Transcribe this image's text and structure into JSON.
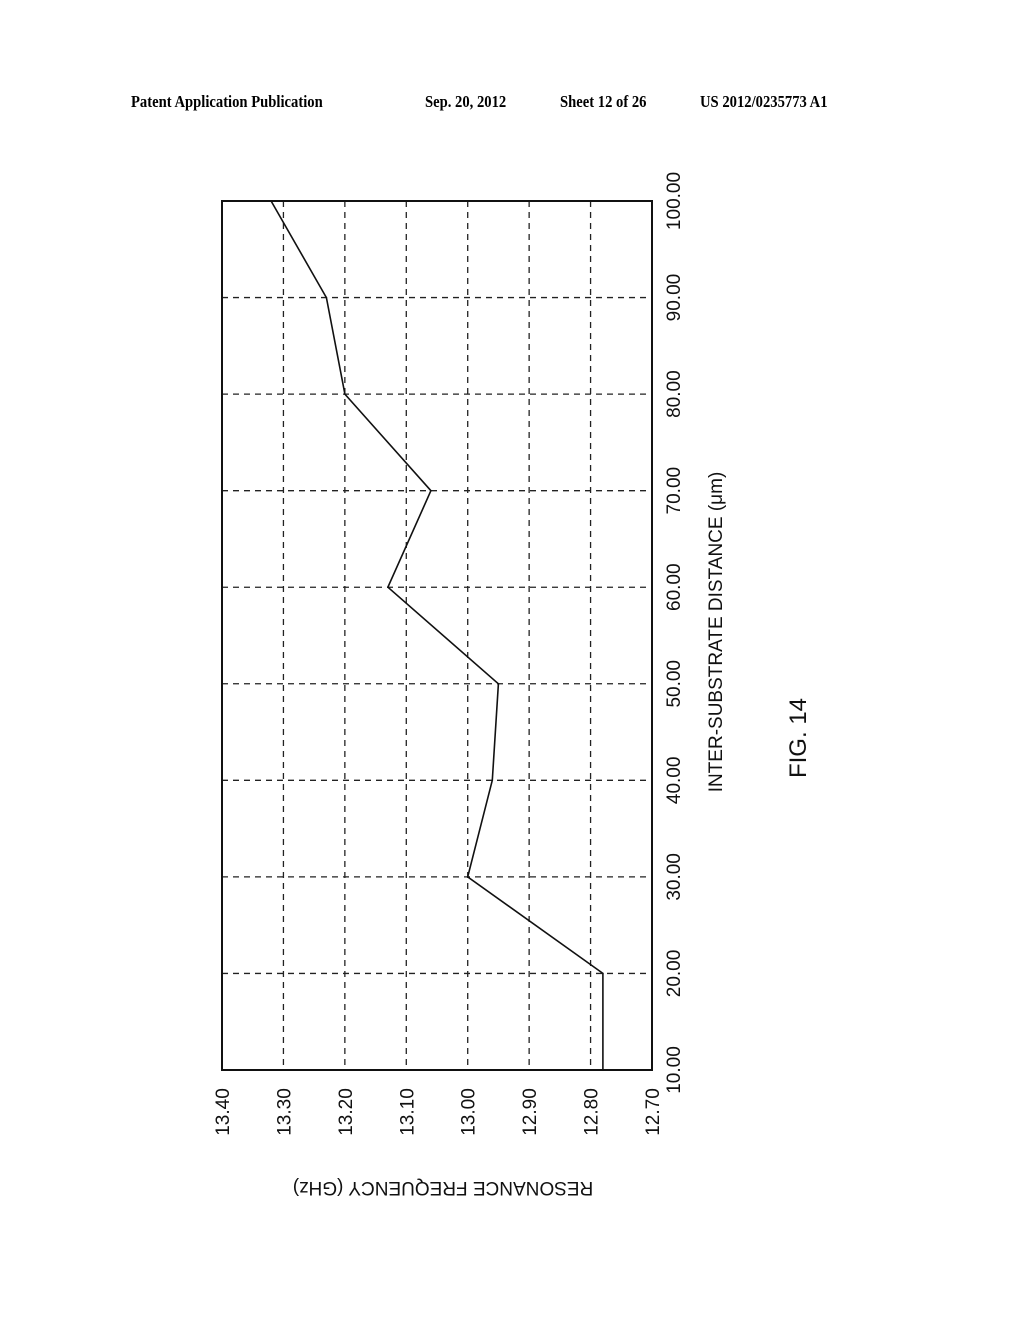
{
  "header": {
    "publication": "Patent Application Publication",
    "date": "Sep. 20, 2012",
    "sheet": "Sheet 12 of 26",
    "number": "US 2012/0235773 A1"
  },
  "figure_label": "FIG. 14",
  "chart_data": {
    "type": "line",
    "title": "",
    "orientation": "rotated 90° counter-clockwise on the page",
    "xlabel": "INTER-SUBSTRATE DISTANCE (μm)",
    "ylabel": "RESONANCE FREQUENCY (GHz)",
    "xlim": [
      10,
      100
    ],
    "ylim": [
      12.7,
      13.4
    ],
    "x_ticks": [
      "10.00",
      "20.00",
      "30.00",
      "40.00",
      "50.00",
      "60.00",
      "70.00",
      "80.00",
      "90.00",
      "100.00"
    ],
    "y_ticks": [
      "12.70",
      "12.80",
      "12.90",
      "13.00",
      "13.10",
      "13.20",
      "13.30",
      "13.40"
    ],
    "grid": "dashed",
    "legend": "none",
    "series": [
      {
        "name": "resonance frequency",
        "x": [
          10,
          20,
          30,
          40,
          50,
          60,
          70,
          80,
          90,
          100
        ],
        "values": [
          12.78,
          12.78,
          13.0,
          12.96,
          12.95,
          13.13,
          13.06,
          13.2,
          13.23,
          13.32
        ]
      }
    ]
  }
}
